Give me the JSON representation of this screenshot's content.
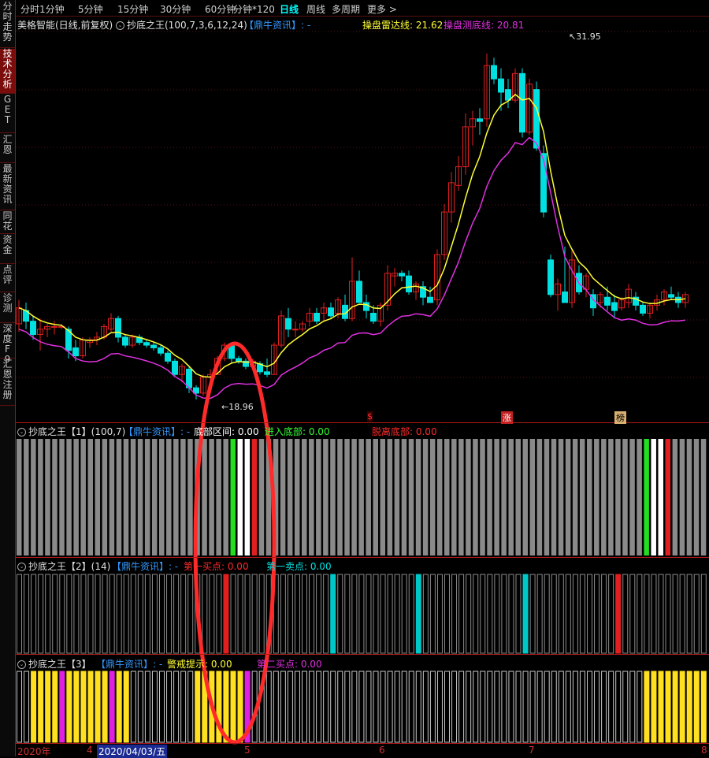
{
  "sidebar": {
    "items": [
      {
        "label": "分时走势",
        "active": false
      },
      {
        "label": "技术分析",
        "active": true
      },
      {
        "label": "GET",
        "active": false
      },
      {
        "label": "汇恩",
        "active": false
      },
      {
        "label": "最新资讯",
        "active": false
      },
      {
        "label": "同花",
        "active": false
      },
      {
        "label": "资金",
        "active": false
      },
      {
        "label": "点评",
        "active": false
      },
      {
        "label": "诊测",
        "active": false
      },
      {
        "label": "深度F9",
        "active": false
      },
      {
        "label": "汇恩注册",
        "active": false
      }
    ]
  },
  "periods": [
    {
      "label": "分时",
      "active": false
    },
    {
      "label": "1分钟",
      "active": false
    },
    {
      "label": "5分钟",
      "active": false
    },
    {
      "label": "15分钟",
      "active": false
    },
    {
      "label": "30分钟",
      "active": false
    },
    {
      "label": "60分钟",
      "active": false
    },
    {
      "label": "分钟*120",
      "active": false
    },
    {
      "label": "日线",
      "active": true
    },
    {
      "label": "周线",
      "active": false
    },
    {
      "label": "多周期",
      "active": false
    },
    {
      "label": "更多 >",
      "active": false
    }
  ],
  "main_panel": {
    "stock": "美格智能(日线,前复权)",
    "indicator": "抄底之王(100,7,3,6,12,24)",
    "source": "【鼎牛资讯】: -",
    "line1_label": "操盘雷达线: 21.62",
    "line2_label": "操盘测底线: 20.81",
    "high_label": "31.95",
    "low_label": "18.96",
    "marks": [
      "$",
      "涨",
      "榜"
    ]
  },
  "sub1": {
    "title": "抄底之王【1】(100,7)",
    "source": "【鼎牛资讯】: -",
    "f1": "底部区间: 0.00",
    "f2": "进入底部: 0.00",
    "f3": "脱离底部: 0.00"
  },
  "sub2": {
    "title": "抄底之王【2】(14)",
    "source": "【鼎牛资讯】: -",
    "f1": "第一买点: 0.00",
    "f2": "第一卖点: 0.00"
  },
  "sub3": {
    "title": "抄底之王【3】",
    "source": "【鼎牛资讯】: -",
    "f1": "警戒提示: 0.00",
    "f2": "第二买点: 0.00"
  },
  "date_axis": {
    "labels": [
      "2020年",
      "4",
      "2020/04/03/五",
      "5",
      "6",
      "7",
      "8"
    ]
  },
  "colors": {
    "up": "#e02020",
    "down": "#00e0e0",
    "radar_line": "#ffff33",
    "bottom_line": "#e030e0",
    "annotation": "#ff2a2a"
  },
  "chart_data": {
    "type": "candlestick",
    "y_high": 31.95,
    "y_low": 18.96,
    "candles": [
      [
        21.8,
        22.7,
        21.5,
        22.4
      ],
      [
        22.3,
        22.6,
        21.6,
        21.9
      ],
      [
        21.9,
        22.1,
        21.2,
        21.4
      ],
      [
        21.4,
        22.0,
        20.8,
        21.6
      ],
      [
        21.6,
        21.8,
        21.3,
        21.7
      ],
      [
        21.7,
        21.9,
        21.4,
        21.7
      ],
      [
        21.7,
        21.8,
        21.6,
        21.7
      ],
      [
        21.6,
        21.7,
        20.5,
        20.8
      ],
      [
        20.9,
        21.2,
        20.4,
        20.6
      ],
      [
        20.6,
        21.3,
        20.5,
        21.2
      ],
      [
        21.1,
        21.3,
        20.9,
        21.2
      ],
      [
        21.2,
        21.5,
        21.0,
        21.3
      ],
      [
        21.3,
        21.8,
        21.2,
        21.7
      ],
      [
        21.6,
        22.2,
        21.5,
        22.0
      ],
      [
        22.0,
        22.1,
        21.1,
        21.3
      ],
      [
        21.3,
        21.4,
        20.9,
        21.0
      ],
      [
        21.0,
        21.4,
        20.9,
        21.3
      ],
      [
        21.3,
        21.4,
        21.0,
        21.1
      ],
      [
        21.1,
        21.2,
        20.9,
        21.0
      ],
      [
        21.0,
        21.1,
        20.8,
        20.9
      ],
      [
        20.9,
        21.0,
        20.6,
        20.7
      ],
      [
        20.7,
        20.8,
        20.3,
        20.4
      ],
      [
        20.4,
        20.5,
        19.8,
        19.9
      ],
      [
        19.9,
        20.3,
        19.6,
        20.2
      ],
      [
        20.1,
        20.2,
        19.2,
        19.4
      ],
      [
        19.4,
        19.5,
        18.96,
        19.2
      ],
      [
        19.2,
        19.9,
        19.1,
        19.8
      ],
      [
        19.8,
        20.1,
        19.7,
        19.9
      ],
      [
        19.9,
        20.6,
        19.9,
        20.5
      ],
      [
        20.5,
        21.1,
        20.4,
        21.0
      ],
      [
        21.0,
        21.1,
        20.3,
        20.5
      ],
      [
        20.5,
        20.6,
        20.3,
        20.4
      ],
      [
        20.4,
        20.5,
        20.1,
        20.2
      ],
      [
        20.2,
        20.5,
        20.1,
        20.4
      ],
      [
        20.3,
        20.4,
        19.9,
        20.0
      ],
      [
        20.0,
        20.5,
        19.8,
        19.9
      ],
      [
        19.9,
        21.1,
        19.9,
        21.0
      ],
      [
        21.0,
        22.3,
        20.9,
        22.1
      ],
      [
        22.0,
        22.4,
        21.3,
        21.6
      ],
      [
        21.6,
        21.9,
        21.3,
        21.6
      ],
      [
        21.6,
        21.9,
        21.5,
        21.8
      ],
      [
        21.9,
        22.4,
        21.7,
        22.2
      ],
      [
        22.2,
        22.4,
        21.8,
        21.9
      ],
      [
        22.2,
        22.6,
        21.9,
        22.4
      ],
      [
        22.4,
        22.6,
        22.0,
        22.1
      ],
      [
        22.2,
        22.8,
        22.0,
        22.7
      ],
      [
        22.5,
        22.9,
        21.9,
        22.0
      ],
      [
        22.0,
        24.3,
        21.9,
        23.4
      ],
      [
        23.4,
        23.8,
        22.6,
        22.6
      ],
      [
        22.6,
        22.9,
        22.0,
        22.3
      ],
      [
        22.2,
        22.5,
        21.8,
        21.9
      ],
      [
        21.9,
        22.6,
        21.7,
        22.5
      ],
      [
        22.5,
        24.0,
        22.3,
        23.7
      ],
      [
        23.6,
        23.9,
        23.2,
        23.7
      ],
      [
        23.7,
        23.8,
        23.4,
        23.6
      ],
      [
        23.6,
        23.8,
        22.9,
        23.0
      ],
      [
        23.0,
        23.4,
        22.7,
        23.3
      ],
      [
        23.2,
        23.4,
        22.5,
        22.8
      ],
      [
        22.8,
        23.2,
        22.6,
        22.6
      ],
      [
        22.7,
        24.6,
        22.5,
        24.4
      ],
      [
        24.4,
        26.3,
        24.2,
        26.0
      ],
      [
        26.0,
        27.5,
        25.6,
        27.1
      ],
      [
        27.0,
        28.1,
        26.8,
        27.7
      ],
      [
        27.7,
        29.7,
        27.4,
        29.2
      ],
      [
        29.2,
        29.8,
        28.5,
        29.5
      ],
      [
        29.5,
        29.9,
        28.9,
        29.4
      ],
      [
        29.5,
        31.95,
        29.2,
        31.5
      ],
      [
        31.5,
        31.8,
        30.8,
        31.0
      ],
      [
        31.0,
        31.4,
        29.8,
        30.5
      ],
      [
        30.6,
        31.0,
        29.9,
        30.2
      ],
      [
        30.2,
        31.4,
        30.1,
        31.2
      ],
      [
        31.2,
        31.4,
        28.8,
        29.0
      ],
      [
        29.0,
        31.0,
        28.9,
        30.8
      ],
      [
        30.6,
        30.9,
        28.3,
        28.4
      ],
      [
        28.2,
        28.5,
        25.8,
        26.0
      ],
      [
        24.2,
        24.4,
        22.8,
        22.9
      ],
      [
        22.9,
        23.5,
        22.3,
        23.3
      ],
      [
        23.0,
        24.7,
        22.6,
        22.6
      ],
      [
        22.6,
        24.6,
        22.4,
        24.2
      ],
      [
        23.7,
        24.0,
        22.9,
        23.0
      ],
      [
        23.1,
        23.7,
        22.8,
        23.6
      ],
      [
        22.9,
        23.1,
        22.1,
        22.4
      ],
      [
        22.6,
        23.0,
        22.4,
        22.9
      ],
      [
        22.8,
        23.2,
        22.3,
        22.5
      ],
      [
        22.6,
        22.9,
        22.0,
        22.3
      ],
      [
        22.4,
        22.8,
        22.3,
        22.7
      ],
      [
        22.6,
        23.3,
        22.4,
        23.1
      ],
      [
        22.8,
        23.0,
        22.3,
        22.5
      ],
      [
        22.5,
        22.6,
        22.1,
        22.2
      ],
      [
        22.2,
        22.6,
        22.0,
        22.5
      ],
      [
        22.5,
        22.9,
        22.3,
        22.7
      ],
      [
        22.7,
        23.1,
        22.5,
        23.0
      ],
      [
        22.9,
        23.2,
        22.7,
        22.8
      ],
      [
        22.8,
        23.0,
        22.4,
        22.6
      ],
      [
        22.6,
        23.0,
        22.4,
        22.9
      ]
    ],
    "radar_line_last": 21.62,
    "bottom_line_last": 20.81
  }
}
